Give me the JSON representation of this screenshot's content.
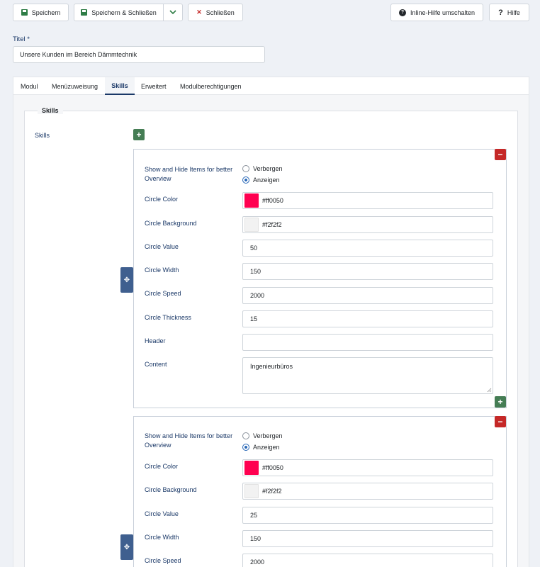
{
  "toolbar": {
    "save_label": "Speichern",
    "save_close_label": "Speichern & Schließen",
    "close_label": "Schließen",
    "inline_help_label": "Inline-Hilfe umschalten",
    "help_label": "Hilfe"
  },
  "title_field": {
    "label": "Titel *",
    "value": "Unsere Kunden im Bereich Dämmtechnik"
  },
  "tabs": [
    {
      "label": "Modul"
    },
    {
      "label": "Menüzuweisung"
    },
    {
      "label": "Skills",
      "active": true
    },
    {
      "label": "Erweitert"
    },
    {
      "label": "Modulberechtigungen"
    }
  ],
  "skills_section": {
    "legend": "Skills",
    "field_label": "Skills",
    "items": [
      {
        "show_hide_label": "Show and Hide Items for better Overview",
        "option_hide": "Verbergen",
        "option_show": "Anzeigen",
        "selected": "Anzeigen",
        "circle_color_label": "Circle Color",
        "circle_color": "#ff0050",
        "circle_background_label": "Circle Background",
        "circle_background": "#f2f2f2",
        "circle_value_label": "Circle Value",
        "circle_value": "50",
        "circle_width_label": "Circle Width",
        "circle_width": "150",
        "circle_speed_label": "Circle Speed",
        "circle_speed": "2000",
        "circle_thickness_label": "Circle Thickness",
        "circle_thickness": "15",
        "header_label": "Header",
        "header": "",
        "content_label": "Content",
        "content": "Ingenieurbüros"
      },
      {
        "show_hide_label": "Show and Hide Items for better Overview",
        "option_hide": "Verbergen",
        "option_show": "Anzeigen",
        "selected": "Anzeigen",
        "circle_color_label": "Circle Color",
        "circle_color": "#ff0050",
        "circle_background_label": "Circle Background",
        "circle_background": "#f2f2f2",
        "circle_value_label": "Circle Value",
        "circle_value": "25",
        "circle_width_label": "Circle Width",
        "circle_width": "150",
        "circle_speed_label": "Circle Speed",
        "circle_speed": "2000"
      }
    ]
  },
  "colors": {
    "save_icon": "#2f7d46",
    "close_icon": "#c52827",
    "label_text": "#1a3867",
    "add_button": "#457d54",
    "remove_button": "#c52827",
    "move_handle": "#3f5f8f"
  }
}
